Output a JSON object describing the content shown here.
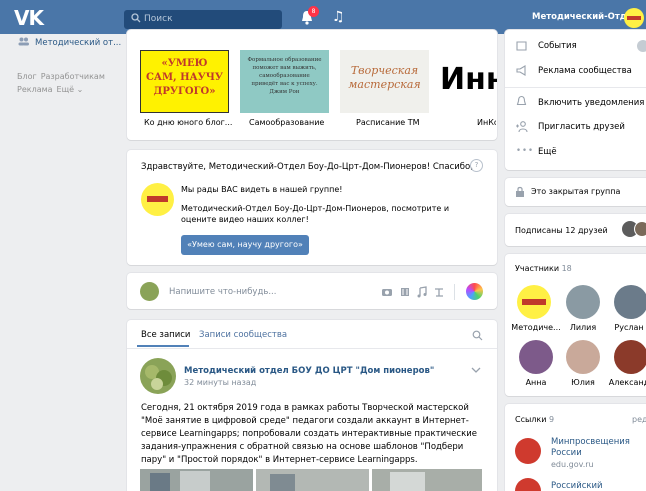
{
  "header": {
    "logo": "VK",
    "search_placeholder": "Поиск",
    "notifications_count": "8",
    "user_name": "Методический-Отдел"
  },
  "left_menu": {
    "groups_item": "Методический от...",
    "links": [
      "Блог",
      "Разработчикам",
      "Реклама",
      "Ещё ⌄"
    ]
  },
  "videos": [
    {
      "caption": "Ко дню юного блог...",
      "thumb_text": "«УМЕЮ САМ, НАУЧУ ДРУГОГО»"
    },
    {
      "caption": "Самообразование",
      "thumb_text": "Формальное образование поможет вам выжить, самообразование приведёт вас к успеху. Джим Рон"
    },
    {
      "caption": "Расписание ТМ",
      "thumb_text": "Творческая мастерская"
    },
    {
      "caption": "ИнКо",
      "thumb_text": "Инн"
    }
  ],
  "welcome": {
    "greeting": "Здравствуйте, Методический-Отдел Боу-До-Црт-Дом-Пионеров! Спасибо,",
    "line1": "Мы рады ВАС видеть в нашей группе!",
    "line2": "Методический-Отдел Боу-До-Црт-Дом-Пионеров, посмотрите и оцените видео наших коллег!",
    "button": "«Умею сам, научу другого»"
  },
  "composer": {
    "placeholder": "Напишите что-нибудь..."
  },
  "wall_tabs": {
    "all": "Все записи",
    "community": "Записи сообщества"
  },
  "post": {
    "author": "Методический отдел БОУ ДО ЦРТ \"Дом пионеров\"",
    "time": "32 минуты назад",
    "text": "Сегодня, 21 октября 2019 года в рамках работы Творческой мастерской \"Моё занятие в цифровой среде\" педагоги создали аккаунт в Интернет-сервисе Learningapps; попробовали создать интерактивные практические задания-упражнения с обратной связью на основе шаблонов \"Подбери пару\" и \"Простой порядок\" в Интернет-сервисе Learningapps."
  },
  "right": {
    "menu": [
      "События",
      "Реклама сообщества",
      "Включить уведомления",
      "Пригласить друзей",
      "Ещё"
    ],
    "closed_group": "Это закрытая группа",
    "friends_subscribed": "Подписаны 12 друзей",
    "members_title": "Участники",
    "members_count": "18",
    "members": [
      "Методиче...",
      "Лилия",
      "Руслан",
      "Анна",
      "Юлия",
      "Александ"
    ],
    "links_title": "Ссылки",
    "links_count": "9",
    "links_edit": "ред",
    "link1_title": "Минпросвещения России",
    "link1_url": "edu.gov.ru",
    "link2_title": "Российский"
  },
  "colors": {
    "header": "#4a76a8",
    "link": "#2a5885",
    "button": "#5181b8",
    "background": "#edeef0"
  }
}
